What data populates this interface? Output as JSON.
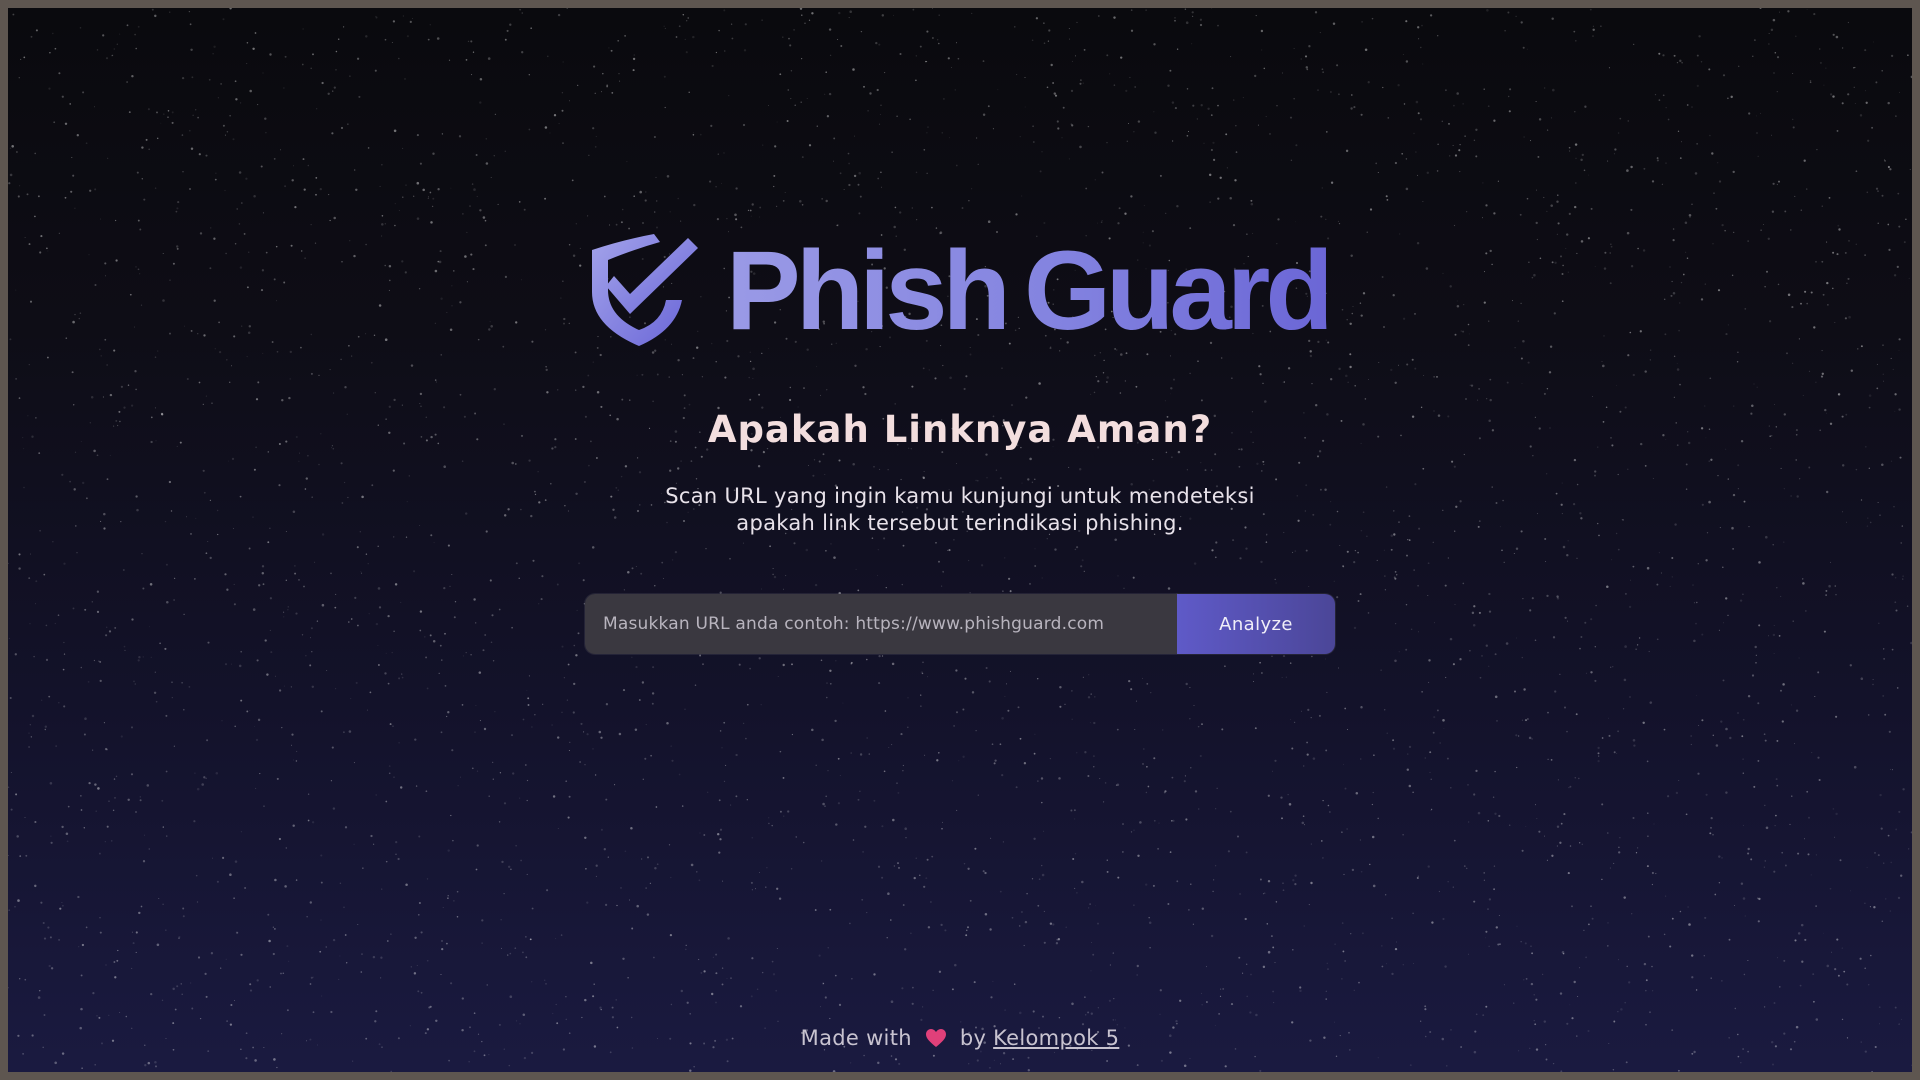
{
  "brand": {
    "name_part1": "Phish",
    "name_part2": "Guard",
    "logo_icon": "shield-check-icon",
    "colors": {
      "gradient_start": "#9a9ae6",
      "gradient_end": "#6b66d6"
    }
  },
  "hero": {
    "headline": "Apakah Linknya Aman?",
    "subtitle_line1": "Scan URL yang ingin kamu kunjungi untuk mendeteksi",
    "subtitle_line2": "apakah link tersebut terindikasi phishing."
  },
  "scan_form": {
    "url_placeholder": "Masukkan URL anda contoh: https://www.phishguard.com",
    "url_value": "",
    "analyze_label": "Analyze",
    "button_color": "#5f5ac8"
  },
  "footer": {
    "made_with": "Made with",
    "heart_icon": "heart-icon",
    "by": "by",
    "team_link": "Kelompok 5",
    "heart_color": "#e0407a"
  }
}
